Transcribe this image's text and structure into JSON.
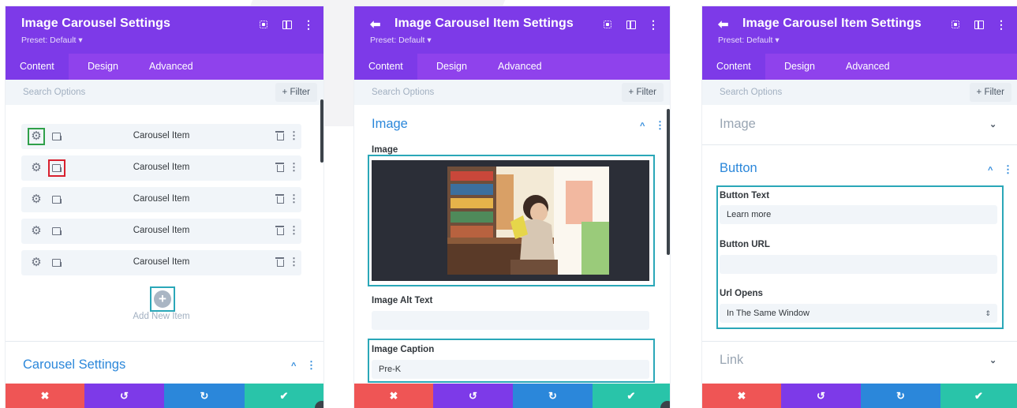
{
  "panel_items": {
    "header": {
      "title": "Image Carousel Settings",
      "preset": "Preset: Default ▾"
    },
    "tabs": [
      "Content",
      "Design",
      "Advanced"
    ],
    "search": {
      "placeholder": "Search Options",
      "filter": "+ Filter"
    },
    "items": [
      "Carousel Item",
      "Carousel Item",
      "Carousel Item",
      "Carousel Item",
      "Carousel Item"
    ],
    "add_new": "Add New Item",
    "add_plus": "+",
    "section": "Carousel Settings"
  },
  "panel_image": {
    "header": {
      "title": "Image Carousel Item Settings",
      "preset": "Preset: Default ▾"
    },
    "tabs": [
      "Content",
      "Design",
      "Advanced"
    ],
    "search": {
      "placeholder": "Search Options",
      "filter": "+ Filter"
    },
    "section": "Image",
    "image_label": "Image",
    "alt_label": "Image Alt Text",
    "alt_value": "",
    "caption_label": "Image Caption",
    "caption_value": "Pre-K"
  },
  "panel_button": {
    "header": {
      "title": "Image Carousel Item Settings",
      "preset": "Preset: Default ▾"
    },
    "tabs": [
      "Content",
      "Design",
      "Advanced"
    ],
    "search": {
      "placeholder": "Search Options",
      "filter": "+ Filter"
    },
    "section_image": "Image",
    "section_button": "Button",
    "button_text_label": "Button Text",
    "button_text_value": "Learn more",
    "button_url_label": "Button URL",
    "button_url_value": "",
    "url_opens_label": "Url Opens",
    "url_opens_value": "In The Same Window",
    "section_link": "Link"
  },
  "glyphs": {
    "back": "⬅",
    "kebab": "⋮",
    "gear": "⚙",
    "chevron_up": "^",
    "chevron_down": "⌄",
    "select": "⇕",
    "cancel": "✖",
    "undo": "↺",
    "redo": "↻",
    "save": "✔"
  },
  "colors": {
    "header": "#7d3ae8",
    "tabs": "#8f42ec",
    "accent_blue": "#2b87da",
    "highlight_teal": "#2aa7b8",
    "highlight_green": "#2fa04a",
    "highlight_red": "#d8202e",
    "cancel": "#ef5555",
    "undo": "#7d3ae8",
    "redo": "#2b87da",
    "save": "#29c4a9"
  }
}
